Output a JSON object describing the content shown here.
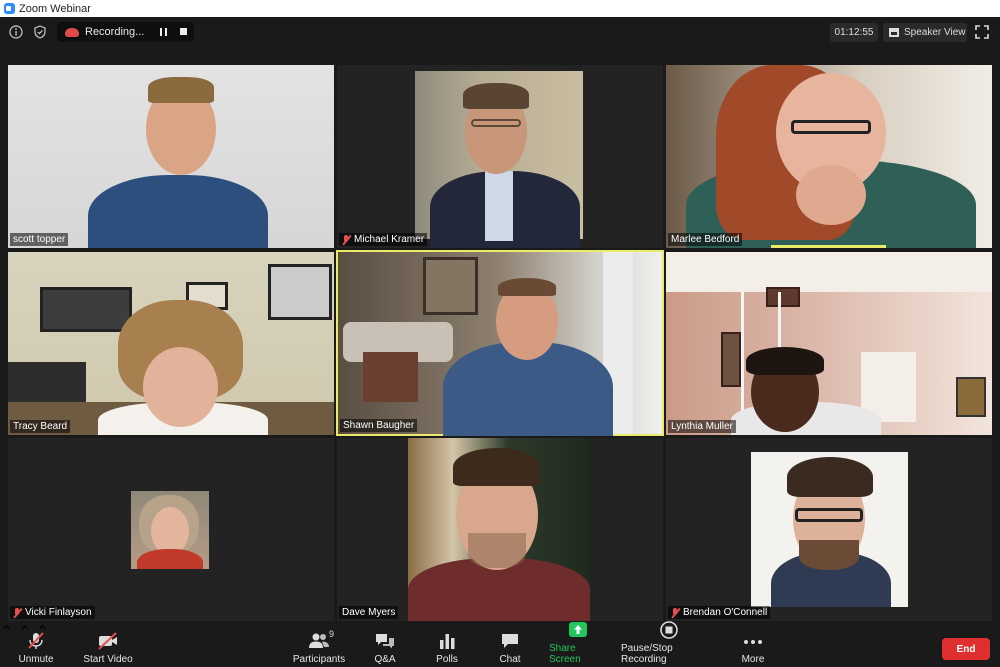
{
  "window": {
    "title": "Zoom Webinar"
  },
  "topbar": {
    "recording_label": "Recording...",
    "timer": "01:12:55",
    "view_label": "Speaker View"
  },
  "participants": [
    {
      "name": "scott topper",
      "muted": false
    },
    {
      "name": "Michael Kramer",
      "muted": true
    },
    {
      "name": "Marlee Bedford",
      "muted": false
    },
    {
      "name": "Tracy Beard",
      "muted": false
    },
    {
      "name": "Shawn Baugher",
      "muted": false,
      "active_speaker": true
    },
    {
      "name": "Lynthia Muller",
      "muted": false
    },
    {
      "name": "Vicki Finlayson",
      "muted": true
    },
    {
      "name": "Dave Myers",
      "muted": false
    },
    {
      "name": "Brendan O'Connell",
      "muted": true
    }
  ],
  "toolbar": {
    "unmute_label": "Unmute",
    "start_video_label": "Start Video",
    "participants_label": "Participants",
    "participants_count": "9",
    "qa_label": "Q&A",
    "polls_label": "Polls",
    "chat_label": "Chat",
    "share_label": "Share Screen",
    "recording_label": "Pause/Stop Recording",
    "more_label": "More",
    "end_label": "End"
  },
  "colors": {
    "active_border": "#e9e96a",
    "share_green": "#22c55e",
    "end_red": "#e02f2f",
    "muted_red": "#e35050"
  }
}
